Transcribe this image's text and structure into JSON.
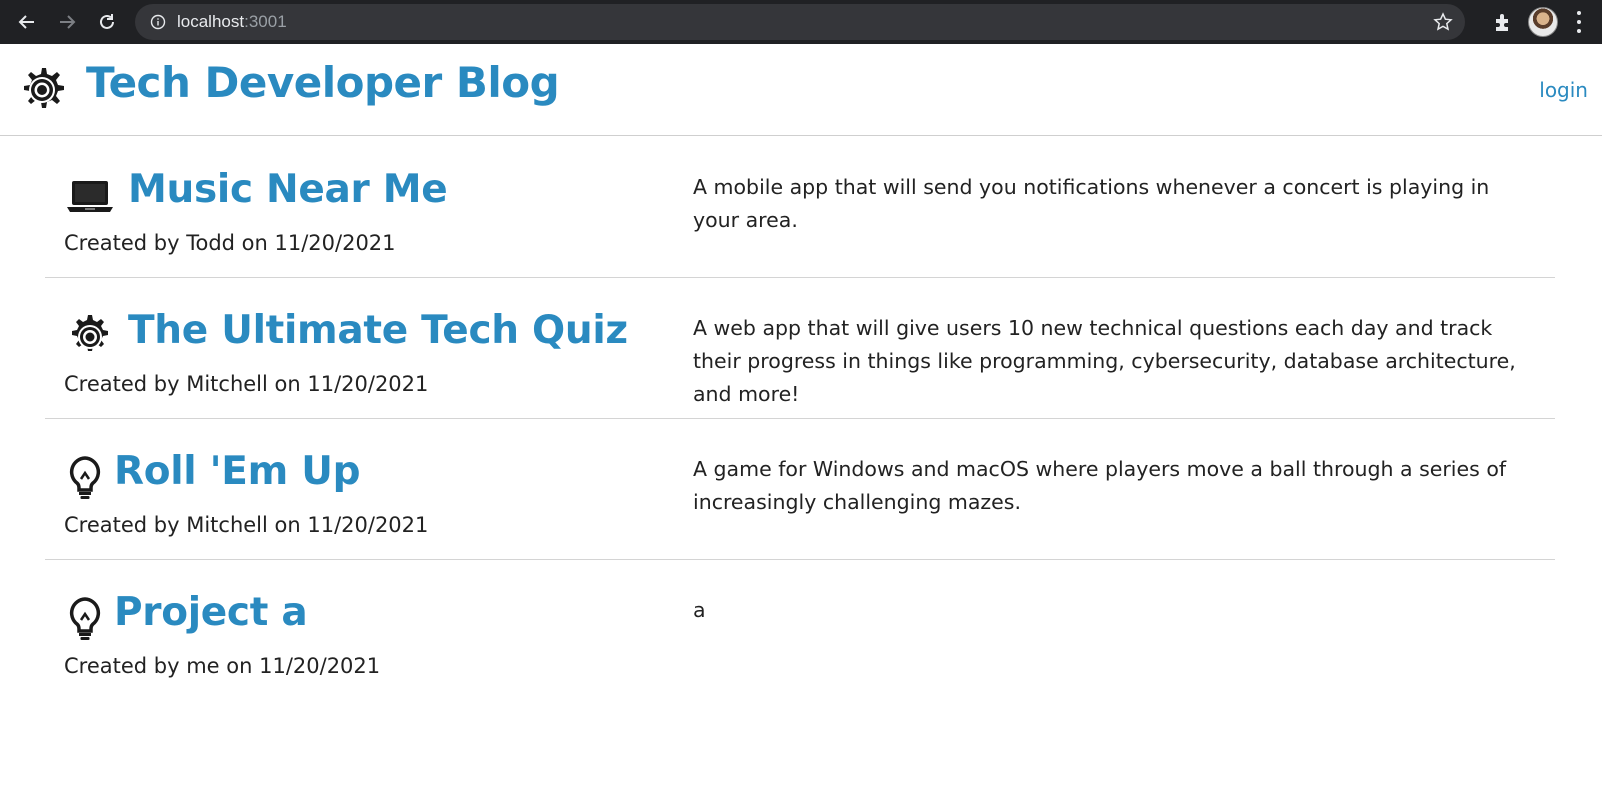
{
  "browser": {
    "url_host": "localhost",
    "url_port": ":3001"
  },
  "site": {
    "title": "Tech Developer Blog",
    "logo_icon": "gear-icon",
    "login_label": "login",
    "accent_color": "#2a8ac0"
  },
  "posts": [
    {
      "icon": "laptop-icon",
      "title": "Music Near Me",
      "meta": "Created by Todd on 11/20/2021",
      "description": "A mobile app that will send you notifications whenever a concert is playing in your area."
    },
    {
      "icon": "gear-icon",
      "title": "The Ultimate Tech Quiz",
      "meta": "Created by Mitchell on 11/20/2021",
      "description": "A web app that will give users 10 new technical questions each day and track their progress in things like programming, cybersecurity, database architecture, and more!"
    },
    {
      "icon": "lightbulb-icon",
      "title": "Roll 'Em Up",
      "meta": "Created by Mitchell on 11/20/2021",
      "description": "A game for Windows and macOS where players move a ball through a series of increasingly challenging mazes."
    },
    {
      "icon": "lightbulb-icon",
      "title": "Project a",
      "meta": "Created by me on 11/20/2021",
      "description": "a"
    }
  ]
}
